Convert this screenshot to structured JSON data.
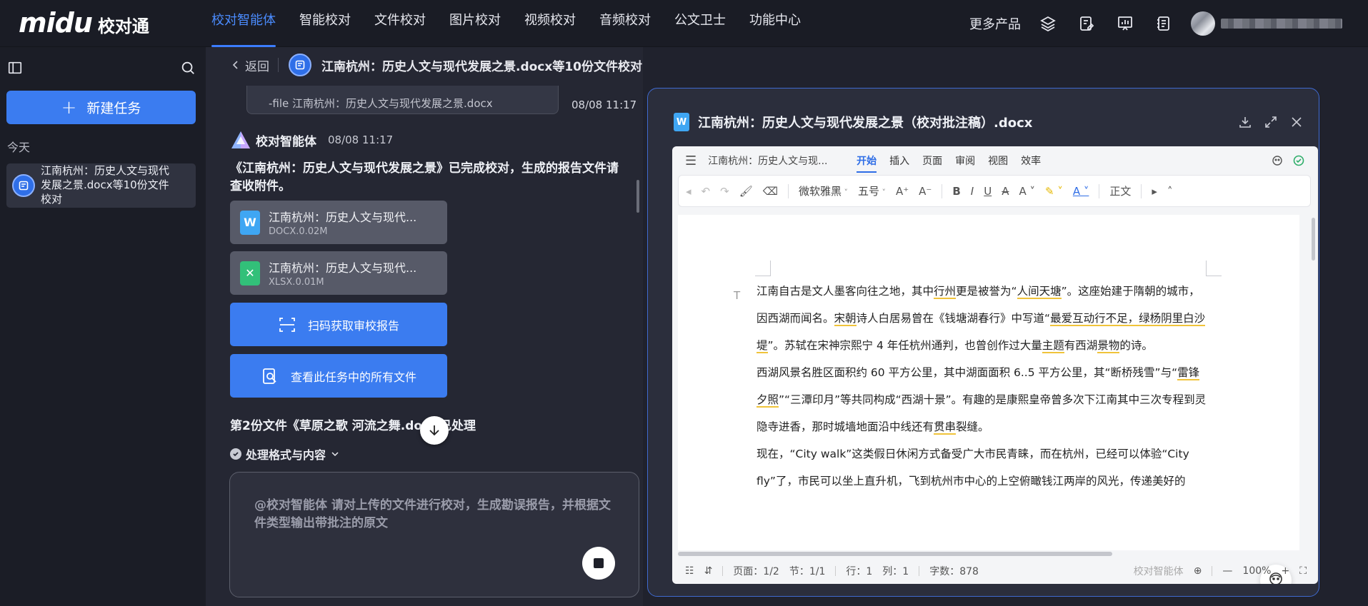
{
  "brand": {
    "logo_word": "midu",
    "logo_cn": "校对通"
  },
  "nav": {
    "items": [
      "校对智能体",
      "智能校对",
      "文件校对",
      "图片校对",
      "视频校对",
      "音频校对",
      "公文卫士",
      "功能中心"
    ],
    "active_index": 0,
    "more_products": "更多产品"
  },
  "sidebar": {
    "new_task_label": "新建任务",
    "today_label": "今天",
    "history": [
      {
        "title": "江南杭州：历史人文与现代发展之景.docx等10份文件校对"
      }
    ]
  },
  "conversation": {
    "back_label": "返回",
    "task_title": "江南杭州：历史人文与现代发展之景.docx等10份文件校对",
    "user_message": "-file 江南杭州：历史人文与现代发展之景.docx",
    "user_time": "08/08 11:17",
    "agent_name": "校对智能体",
    "agent_time": "08/08 11:17",
    "result_text": "《江南杭州：历史人文与现代发展之景》已完成校对，生成的报告文件请查收附件。",
    "attachments": [
      {
        "name": "江南杭州：历史人文与现代...",
        "size": "DOCX.0.02M",
        "type": "docx"
      },
      {
        "name": "江南杭州：历史人文与现代...",
        "size": "XLSX.0.01M",
        "type": "xlsx"
      }
    ],
    "scan_button": "扫码获取审校报告",
    "view_all_button": "查看此任务中的所有文件",
    "file2_text": "第2份文件《草原之歌 河流之舞.do",
    "file2_suffix": "已处理",
    "process_label": "处理格式与内容",
    "input_placeholder": "@校对智能体 请对上传的文件进行校对，生成勘误报告，并根据文件类型输出带批注的原文"
  },
  "document": {
    "title": "江南杭州：历史人文与现代发展之景（校对批注稿）.docx",
    "short_name": "江南杭州：历史人文与现...",
    "tabs": [
      "开始",
      "插入",
      "页面",
      "审阅",
      "视图",
      "效率"
    ],
    "active_tab": "开始",
    "font_name": "微软雅黑",
    "font_size": "五号",
    "style_label": "正文",
    "paragraphs": [
      [
        "江南自古是文人墨客向往之地，其中",
        {
          "u": "行州"
        },
        "更是被誉为“",
        {
          "u": "人间天塘"
        },
        "”。这座始建于隋朝的城市，因西湖而闻名。",
        {
          "u": "宋朝"
        },
        "诗人白居易曾在《钱塘湖春行》中写道“",
        {
          "u": "最爱互动行不足，绿杨阴里白沙堤"
        },
        "”。苏轼在宋神宗熙宁 4 年任杭州通判，也曾创作过大量",
        {
          "u": "主题"
        },
        "有西湖",
        {
          "u": "景物"
        },
        "的诗。"
      ],
      [
        "西湖风景名胜区面积约 60 平方公里，其中湖面面积 6..5 平方公里，其“断桥残雪”与“",
        {
          "u": "雷锋夕照"
        },
        "”“三潭印月”等共同构成“西湖十景”。有趣的是康熙皇帝曾多次下江南其中三次专程到灵隐寺进香，那时城墙地面沿中线还有",
        {
          "u": "贯串"
        },
        "裂缝。"
      ],
      [
        "现在，“City walk”这类假日休闲方式备受广大市民青睐，而在杭州，已经可以体验“City fly”了，市民可以坐上直升机，飞到杭州市中心的上空俯瞰钱江两岸的风光，传递美好的"
      ]
    ],
    "status": {
      "page": "页面：1/2",
      "section": "节：1/1",
      "row": "行：1",
      "col": "列：1",
      "word_count": "字数：878",
      "agent": "校对智能体",
      "zoom": "100%"
    }
  }
}
